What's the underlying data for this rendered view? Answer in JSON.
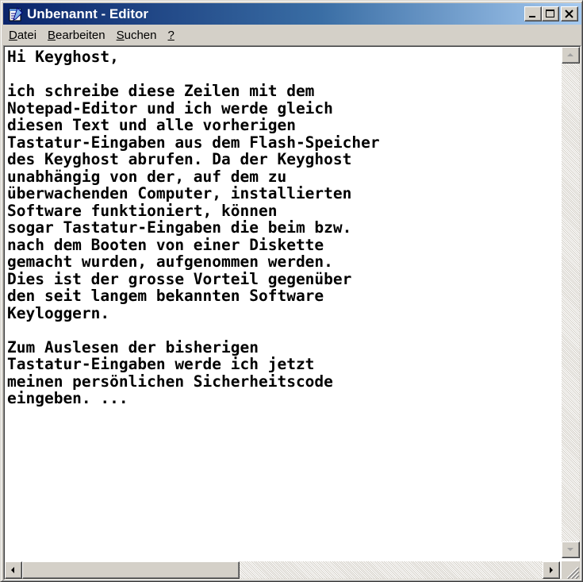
{
  "window": {
    "title": "Unbenannt - Editor",
    "icon": "notepad-icon",
    "accent_color": "#0a246a",
    "accent_color_end": "#a6caf0"
  },
  "caption_buttons": {
    "minimize_icon": "minimize-icon",
    "maximize_icon": "maximize-icon",
    "close_icon": "close-icon"
  },
  "menu": {
    "items": [
      {
        "accel": "D",
        "rest": "atei"
      },
      {
        "accel": "B",
        "rest": "earbeiten"
      },
      {
        "accel": "S",
        "rest": "uchen"
      },
      {
        "accel": "?",
        "rest": ""
      }
    ]
  },
  "editor": {
    "lines": [
      "Hi Keyghost,",
      "",
      "ich schreibe diese Zeilen mit dem",
      "Notepad-Editor und ich werde gleich",
      "diesen Text und alle vorherigen",
      "Tastatur-Eingaben aus dem Flash-Speicher",
      "des Keyghost abrufen. Da der Keyghost",
      "unabhängig von der, auf dem zu",
      "überwachenden Computer, installierten",
      "Software funktioniert, können",
      "sogar Tastatur-Eingaben die beim bzw.",
      "nach dem Booten von einer Diskette",
      "gemacht wurden, aufgenommen werden.",
      "Dies ist der grosse Vorteil gegenüber",
      "den seit langem bekannten Software",
      "Keyloggern.",
      "",
      "Zum Auslesen der bisherigen",
      "Tastatur-Eingaben werde ich jetzt",
      "meinen persönlichen Sicherheitscode",
      "eingeben. ..."
    ]
  }
}
